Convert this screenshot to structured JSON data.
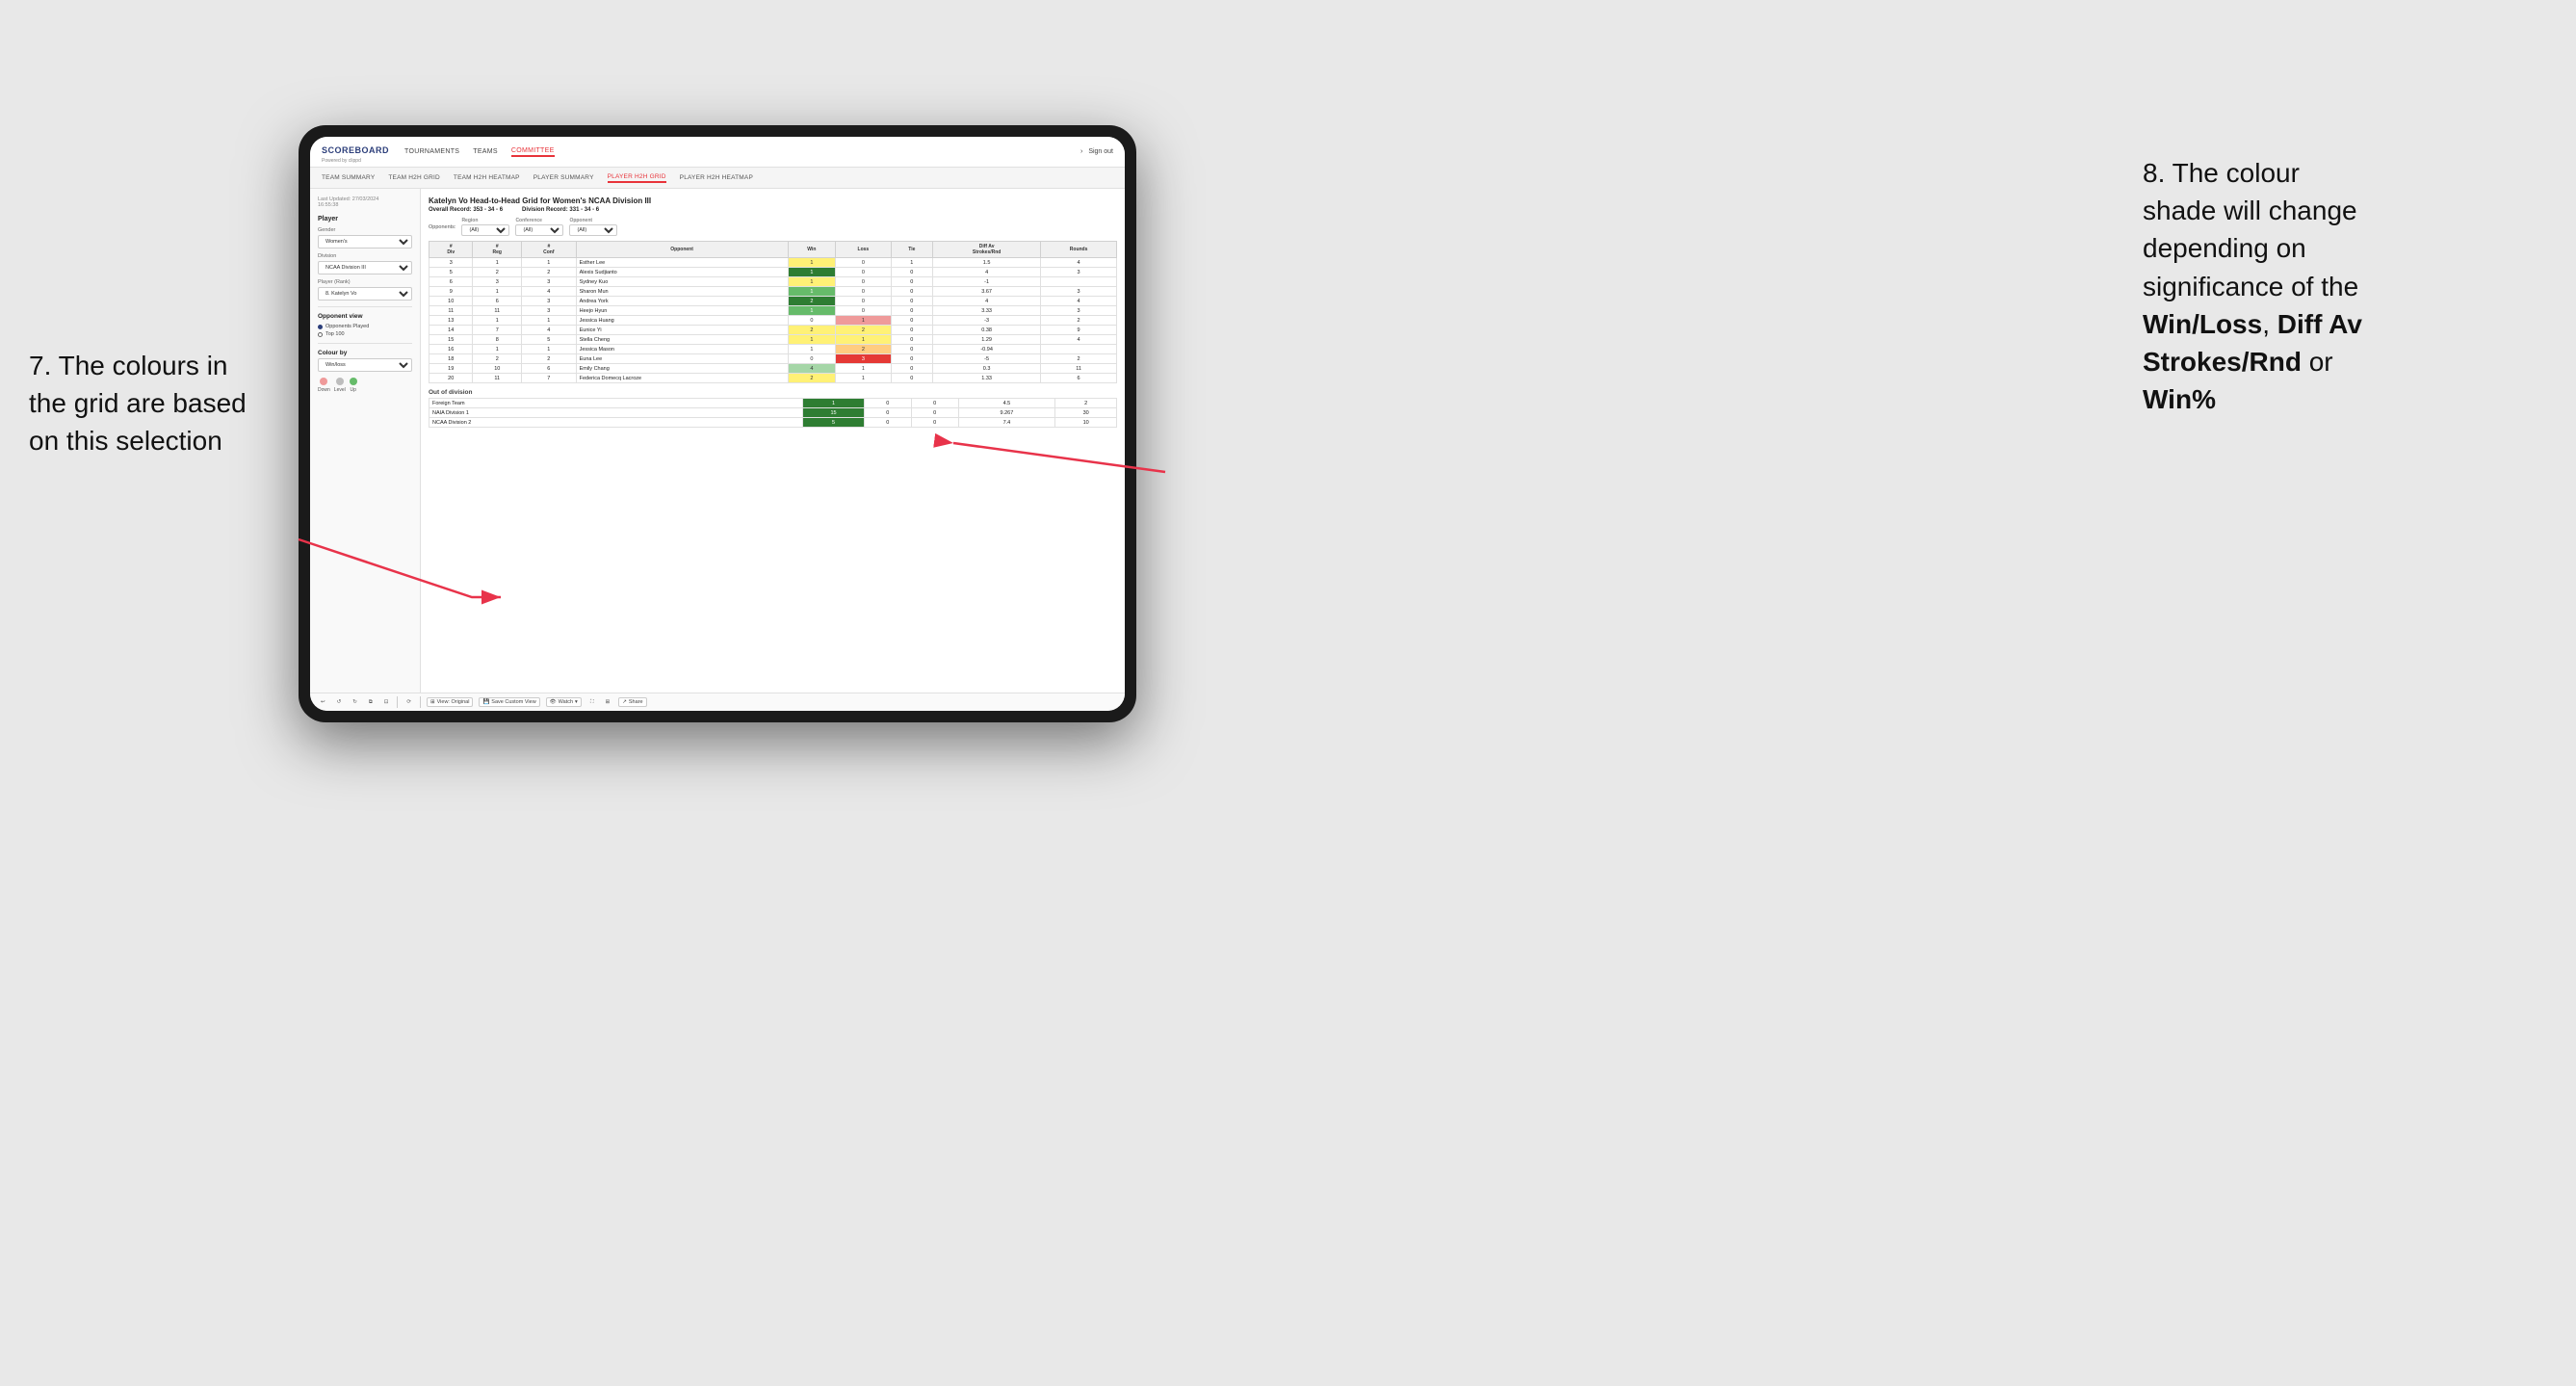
{
  "annotation_left": {
    "line1": "7. The colours in",
    "line2": "the grid are based",
    "line3": "on this selection"
  },
  "annotation_right": {
    "line1": "8. The colour",
    "line2": "shade will change",
    "line3": "depending on",
    "line4": "significance of the",
    "bold1": "Win/Loss",
    "comma": ", ",
    "bold2": "Diff Av",
    "line5": "Strokes/Rnd",
    "line6": "or",
    "bold3": "Win%"
  },
  "nav": {
    "logo": "SCOREBOARD",
    "logo_sub": "Powered by clippd",
    "links": [
      "TOURNAMENTS",
      "TEAMS",
      "COMMITTEE"
    ],
    "active_link": "COMMITTEE",
    "right": "Sign out"
  },
  "sub_nav": {
    "links": [
      "TEAM SUMMARY",
      "TEAM H2H GRID",
      "TEAM H2H HEATMAP",
      "PLAYER SUMMARY",
      "PLAYER H2H GRID",
      "PLAYER H2H HEATMAP"
    ],
    "active": "PLAYER H2H GRID"
  },
  "sidebar": {
    "last_updated_label": "Last Updated: 27/03/2024",
    "last_updated_time": "16:55:38",
    "player_section": "Player",
    "gender_label": "Gender",
    "gender_value": "Women's",
    "division_label": "Division",
    "division_value": "NCAA Division III",
    "player_rank_label": "Player (Rank)",
    "player_rank_value": "8. Katelyn Vo",
    "opponent_view_title": "Opponent view",
    "radio1": "Opponents Played",
    "radio2": "Top 100",
    "colour_by_title": "Colour by",
    "colour_by_value": "Win/loss",
    "legend": {
      "down_label": "Down",
      "level_label": "Level",
      "up_label": "Up"
    }
  },
  "grid": {
    "title": "Katelyn Vo Head-to-Head Grid for Women's NCAA Division III",
    "overall_record_label": "Overall Record:",
    "overall_record_value": "353 - 34 - 6",
    "division_record_label": "Division Record:",
    "division_record_value": "331 - 34 - 6",
    "filters": {
      "region_label": "Region",
      "region_value": "(All)",
      "conference_label": "Conference",
      "conference_value": "(All)",
      "opponent_label": "Opponent",
      "opponent_value": "(All)"
    },
    "opponents_label": "Opponents:",
    "table_headers": [
      "#\nDiv",
      "#\nReg",
      "#\nConf",
      "Opponent",
      "Win",
      "Loss",
      "Tie",
      "Diff Av\nStrokes/Rnd",
      "Rounds"
    ],
    "rows": [
      {
        "div": 3,
        "reg": 1,
        "conf": 1,
        "opponent": "Esther Lee",
        "win": 1,
        "loss": 0,
        "tie": 1,
        "diff": 1.5,
        "rounds": 4,
        "win_color": "yellow",
        "loss_color": "white",
        "tie_color": "white"
      },
      {
        "div": 5,
        "reg": 2,
        "conf": 2,
        "opponent": "Alexis Sudjianto",
        "win": 1,
        "loss": 0,
        "tie": 0,
        "diff": 4.0,
        "rounds": 3,
        "win_color": "green_dark",
        "loss_color": "white",
        "tie_color": "white"
      },
      {
        "div": 6,
        "reg": 3,
        "conf": 3,
        "opponent": "Sydney Kuo",
        "win": 1,
        "loss": 0,
        "tie": 0,
        "diff": -1.0,
        "rounds": "",
        "win_color": "yellow",
        "loss_color": "white",
        "tie_color": "white"
      },
      {
        "div": 9,
        "reg": 1,
        "conf": 4,
        "opponent": "Sharon Mun",
        "win": 1,
        "loss": 0,
        "tie": 0,
        "diff": 3.67,
        "rounds": 3,
        "win_color": "green_med",
        "loss_color": "white",
        "tie_color": "white"
      },
      {
        "div": 10,
        "reg": 6,
        "conf": 3,
        "opponent": "Andrea York",
        "win": 2,
        "loss": 0,
        "tie": 0,
        "diff": 4.0,
        "rounds": 4,
        "win_color": "green_dark",
        "loss_color": "white",
        "tie_color": "white"
      },
      {
        "div": 11,
        "reg": 11,
        "conf": 3,
        "opponent": "Heejo Hyun",
        "win": 1,
        "loss": 0,
        "tie": 0,
        "diff": 3.33,
        "rounds": 3,
        "win_color": "green_med",
        "loss_color": "white",
        "tie_color": "white"
      },
      {
        "div": 13,
        "reg": 1,
        "conf": 1,
        "opponent": "Jessica Huang",
        "win": 0,
        "loss": 1,
        "tie": 0,
        "diff": -3.0,
        "rounds": 2,
        "win_color": "white",
        "loss_color": "red",
        "tie_color": "white"
      },
      {
        "div": 14,
        "reg": 7,
        "conf": 4,
        "opponent": "Eunice Yi",
        "win": 2,
        "loss": 2,
        "tie": 0,
        "diff": 0.38,
        "rounds": 9,
        "win_color": "yellow",
        "loss_color": "yellow",
        "tie_color": "white"
      },
      {
        "div": 15,
        "reg": 8,
        "conf": 5,
        "opponent": "Stella Cheng",
        "win": 1,
        "loss": 1,
        "tie": 0,
        "diff": 1.29,
        "rounds": 4,
        "win_color": "yellow",
        "loss_color": "yellow",
        "tie_color": "white"
      },
      {
        "div": 16,
        "reg": 1,
        "conf": 1,
        "opponent": "Jessica Mason",
        "win": 1,
        "loss": 2,
        "tie": 0,
        "diff": -0.94,
        "rounds": "",
        "win_color": "white",
        "loss_color": "orange",
        "tie_color": "white"
      },
      {
        "div": 18,
        "reg": 2,
        "conf": 2,
        "opponent": "Euna Lee",
        "win": 0,
        "loss": 3,
        "tie": 0,
        "diff": -5.0,
        "rounds": 2,
        "win_color": "white",
        "loss_color": "red_dark",
        "tie_color": "white"
      },
      {
        "div": 19,
        "reg": 10,
        "conf": 6,
        "opponent": "Emily Chang",
        "win": 4,
        "loss": 1,
        "tie": 0,
        "diff": 0.3,
        "rounds": 11,
        "win_color": "green_light",
        "loss_color": "white",
        "tie_color": "white"
      },
      {
        "div": 20,
        "reg": 11,
        "conf": 7,
        "opponent": "Federica Domecq Lacroze",
        "win": 2,
        "loss": 1,
        "tie": 0,
        "diff": 1.33,
        "rounds": 6,
        "win_color": "yellow",
        "loss_color": "white",
        "tie_color": "white"
      }
    ],
    "out_of_division_label": "Out of division",
    "out_of_division_rows": [
      {
        "label": "Foreign Team",
        "win": 1,
        "loss": 0,
        "tie": 0,
        "diff": 4.5,
        "rounds": 2,
        "win_color": "green_dark"
      },
      {
        "label": "NAIA Division 1",
        "win": 15,
        "loss": 0,
        "tie": 0,
        "diff": 9.267,
        "rounds": 30,
        "win_color": "green_dark"
      },
      {
        "label": "NCAA Division 2",
        "win": 5,
        "loss": 0,
        "tie": 0,
        "diff": 7.4,
        "rounds": 10,
        "win_color": "green_dark"
      }
    ]
  },
  "toolbar": {
    "view_original": "View: Original",
    "save_custom": "Save Custom View",
    "watch": "Watch",
    "share": "Share"
  }
}
